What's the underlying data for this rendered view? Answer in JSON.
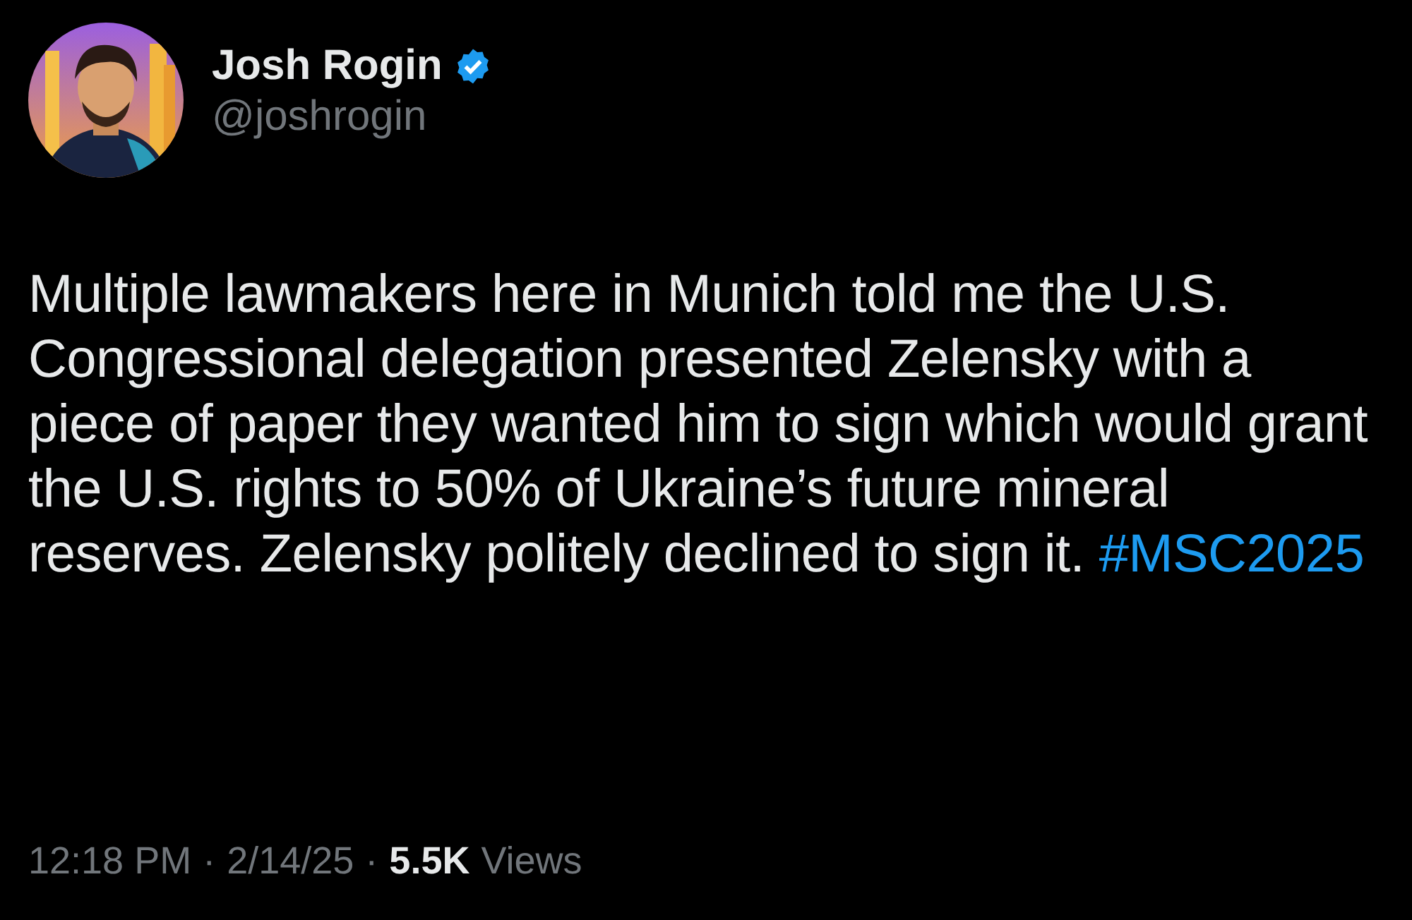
{
  "author": {
    "name": "Josh Rogin",
    "verified": true,
    "handle": "@joshrogin"
  },
  "tweet": {
    "text": "Multiple lawmakers here in Munich told me the U.S. Congressional delegation presented Zelensky with a piece of paper they wanted him to sign which would grant the U.S. rights to 50% of Ukraine’s future mineral reserves. Zelensky politely declined to sign it.",
    "hashtag": "#MSC2025"
  },
  "meta": {
    "time": "12:18 PM",
    "separator_1": "·",
    "date": "2/14/25",
    "separator_2": "·",
    "views_count": "5.5K",
    "views_label": "Views"
  }
}
